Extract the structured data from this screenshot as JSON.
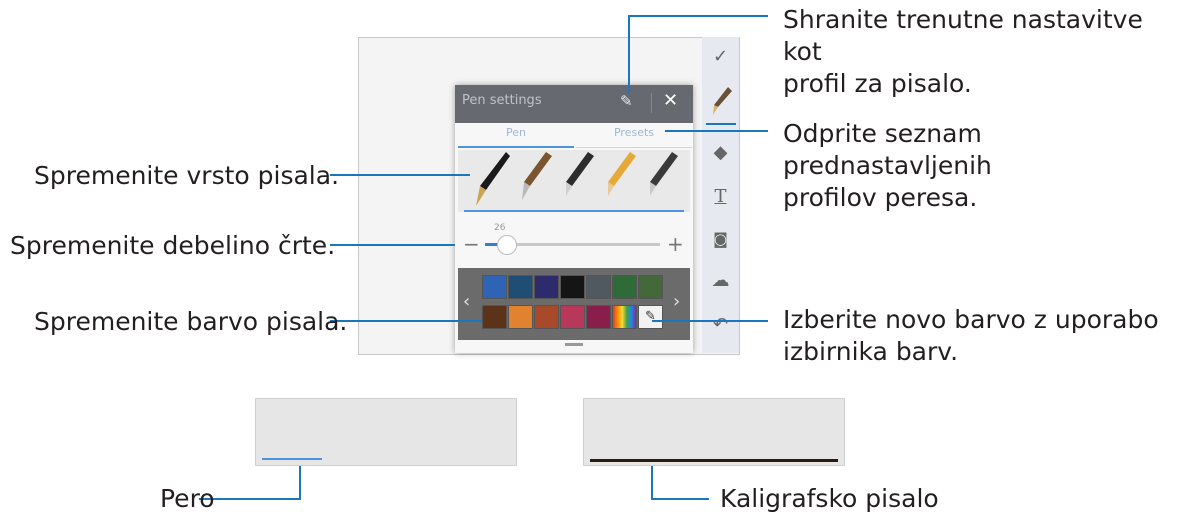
{
  "callouts": {
    "save_profile": "Shranite trenutne nastavitve kot\nprofil za pisalo.",
    "open_presets": "Odprite seznam prednastavljenih\nprofilov peresa.",
    "change_type": "Spremenite vrsto pisala.",
    "change_thickness": "Spremenite debelino črte.",
    "change_color": "Spremenite barvo pisala.",
    "color_picker": "Izberite novo barvo z uporabo\nizbirnika barv.",
    "pen_label": "Pero",
    "calligraphy_label": "Kaligrafsko pisalo"
  },
  "panel": {
    "title": "Pen settings",
    "tabs": [
      "Pen",
      "Presets"
    ],
    "slider_value": "26",
    "slider_level": 0.12
  },
  "icons": {
    "check": "check-icon",
    "pen": "pen-icon",
    "eraser": "eraser-icon",
    "text": "text-icon",
    "camera": "camera-icon",
    "cloud": "cloud-icon",
    "undo": "undo-icon",
    "save_profile": "save-pen-profile-icon",
    "close": "close-icon"
  },
  "palette": {
    "row1": [
      "#2f64b4",
      "#1e4e74",
      "#2d2b6b",
      "#151515",
      "#505860",
      "#2f6b38",
      "#43683a"
    ],
    "row2": [
      "#5c3318",
      "#e0822e",
      "#a84a2a",
      "#b7385b",
      "#8a1e4a"
    ]
  },
  "colors": {
    "accent": "#1a77bd",
    "panel_header": "#666a70"
  }
}
